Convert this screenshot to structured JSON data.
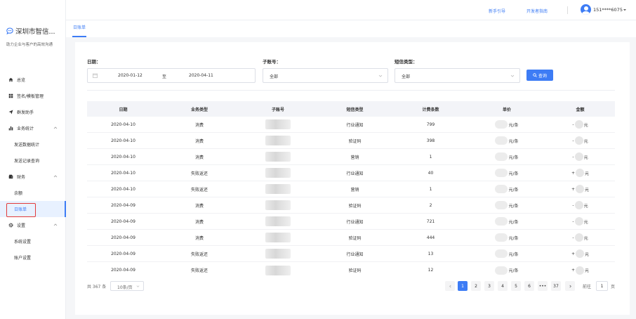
{
  "header": {
    "guide_link": "新手引导",
    "dev_guide_link": "开发者指南",
    "user_phone": "151****6075"
  },
  "brand": {
    "name": "深圳市智信...",
    "slogan": "助力企业与客户的高效沟通"
  },
  "sidebar": {
    "items": [
      {
        "label": "总览",
        "icon": "home-icon"
      },
      {
        "label": "签名/模板管理",
        "icon": "grid-icon"
      },
      {
        "label": "群发助手",
        "icon": "send-icon"
      },
      {
        "label": "业务统计",
        "icon": "chart-icon"
      },
      {
        "label": "发送数据统计"
      },
      {
        "label": "发送记录查询"
      },
      {
        "label": "财务",
        "icon": "wallet-icon"
      },
      {
        "label": "余额"
      },
      {
        "label": "日账单"
      },
      {
        "label": "设置",
        "icon": "gear-icon"
      },
      {
        "label": "系统设置"
      },
      {
        "label": "账户设置"
      }
    ]
  },
  "tab": {
    "label": "日账单"
  },
  "filters": {
    "date_label": "日期：",
    "date_start": "2020-01-12",
    "date_sep": "至",
    "date_end": "2020-04-11",
    "subaccount_label": "子账号：",
    "subaccount_value": "全部",
    "sms_type_label": "短信类型：",
    "sms_type_value": "全部",
    "query_button": "查询"
  },
  "table": {
    "headers": [
      "日期",
      "业务类型",
      "子账号",
      "短信类型",
      "计费条数",
      "单价",
      "金额"
    ],
    "price_unit": "元/条",
    "amount_unit": "元",
    "rows": [
      {
        "date": "2020-04-10",
        "biz": "消费",
        "sms": "行业通知",
        "count": "799",
        "sign": "-"
      },
      {
        "date": "2020-04-10",
        "biz": "消费",
        "sms": "验证码",
        "count": "398",
        "sign": "-"
      },
      {
        "date": "2020-04-10",
        "biz": "消费",
        "sms": "营销",
        "count": "1",
        "sign": "-"
      },
      {
        "date": "2020-04-10",
        "biz": "失败返还",
        "sms": "行业通知",
        "count": "40",
        "sign": "+"
      },
      {
        "date": "2020-04-10",
        "biz": "失败返还",
        "sms": "营销",
        "count": "1",
        "sign": "+"
      },
      {
        "date": "2020-04-09",
        "biz": "消费",
        "sms": "验证码",
        "count": "2",
        "sign": "-"
      },
      {
        "date": "2020-04-09",
        "biz": "消费",
        "sms": "行业通知",
        "count": "721",
        "sign": "-"
      },
      {
        "date": "2020-04-09",
        "biz": "消费",
        "sms": "验证码",
        "count": "444",
        "sign": "-"
      },
      {
        "date": "2020-04-09",
        "biz": "失败返还",
        "sms": "行业通知",
        "count": "13",
        "sign": "+"
      },
      {
        "date": "2020-04-09",
        "biz": "失败返还",
        "sms": "验证码",
        "count": "12",
        "sign": "+"
      }
    ]
  },
  "pagination": {
    "total": "共 367 条",
    "page_size": "10条/页",
    "pages": [
      "1",
      "2",
      "3",
      "4",
      "5",
      "6",
      "•••",
      "37"
    ],
    "current_page": 1,
    "goto_label": "前往",
    "goto_value": "1",
    "goto_unit": "页"
  }
}
